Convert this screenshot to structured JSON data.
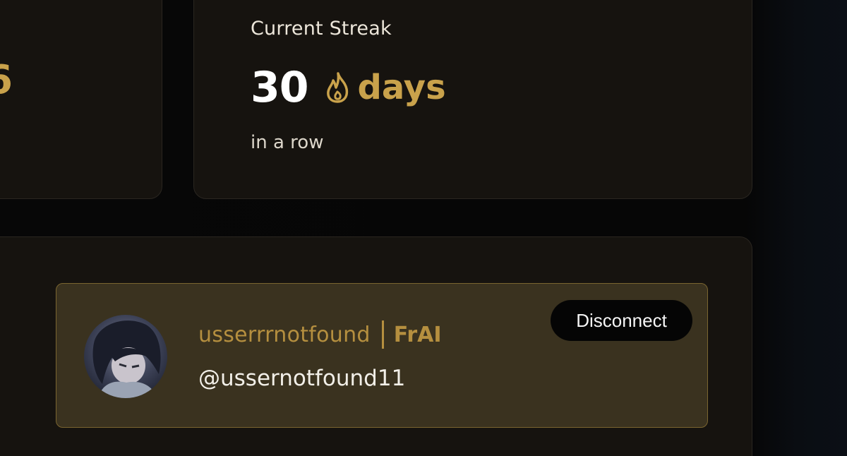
{
  "stats": {
    "left_card_value_fragment": "6",
    "streak": {
      "title": "Current Streak",
      "value": "30",
      "unit": "days",
      "subtitle": "in a row",
      "icon": "flame-icon"
    }
  },
  "account": {
    "display_name": "usserrrnotfound",
    "tag": "FrAI",
    "handle": "@ussernotfound11",
    "disconnect_label": "Disconnect",
    "avatar_icon": "user-avatar"
  },
  "colors": {
    "accent_gold": "#c9a24b",
    "background": "#050505",
    "card": "#16130f",
    "profile_box": "#3a321f"
  }
}
